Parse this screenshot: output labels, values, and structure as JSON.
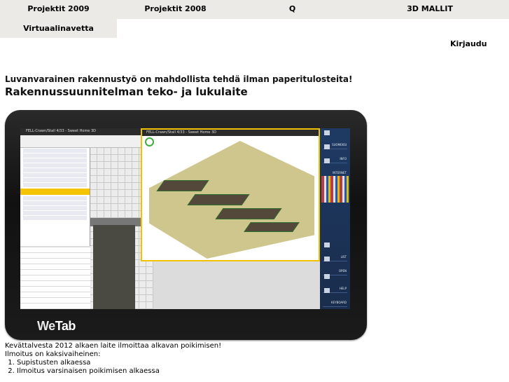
{
  "nav": {
    "row1": [
      "Projektit 2009",
      "Projektit 2008",
      "Q",
      "3D MALLIT"
    ],
    "row2": [
      "Virtuaalinavetta"
    ]
  },
  "login": "Kirjaudu",
  "lead": "Luvanvarainen rakennustyö on mahdollista tehdä ilman paperitulosteita!",
  "title": "Rakennussuunnitelman teko- ja lukulaite",
  "device": {
    "brand_light": "We",
    "brand_bold": "Tab",
    "app_title": "FELL-Crawn/Stall 4/33 - Sweet Home 3D",
    "side_panel": [
      "SUOMEKSI",
      "INFO",
      "INTERNET",
      "LIST",
      "OPEN",
      "HELP",
      "KEYBOARD"
    ]
  },
  "text": {
    "intro": "Kevättalvesta 2012 alkaen laite ilmoittaa alkavan poikimisen!",
    "phases": "Ilmoitus on kaksivaiheinen:",
    "steps": [
      "Supistusten alkaessa",
      "Ilmoitus varsinaisen poikimisen alkaessa"
    ]
  },
  "colors": {
    "nav_bg": "#ebeae6",
    "highlight": "#f5c400",
    "panel": "#1e3a63"
  }
}
